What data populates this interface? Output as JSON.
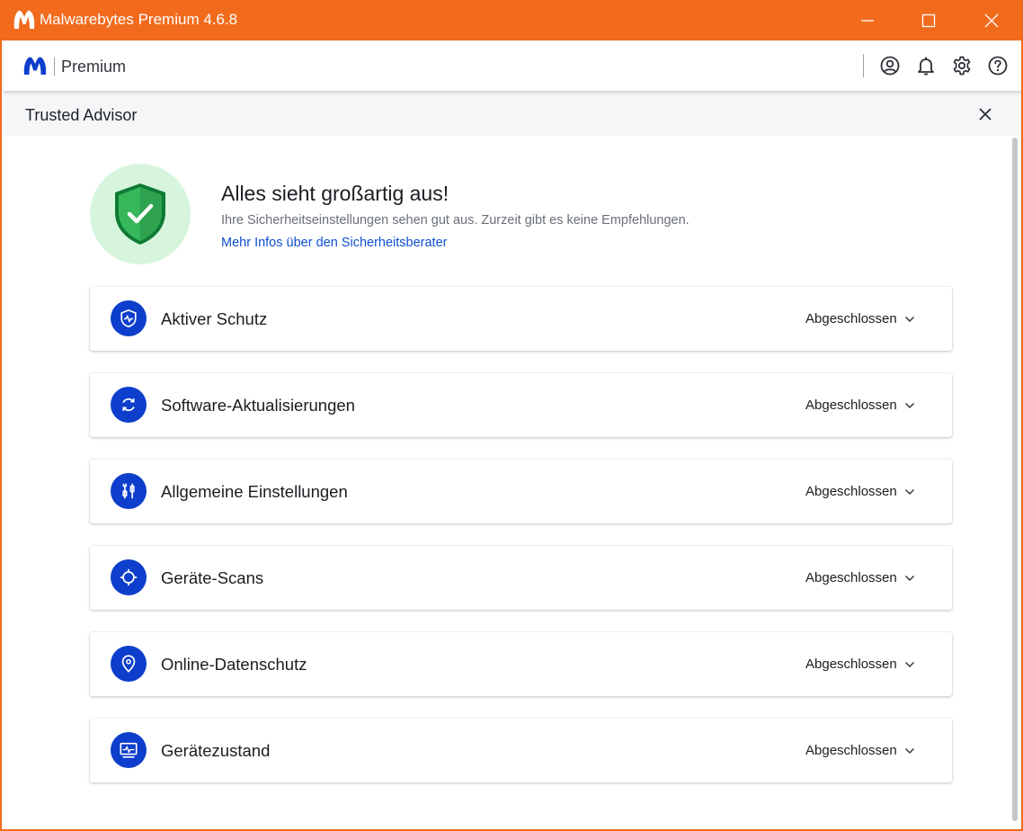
{
  "window": {
    "title": "Malwarebytes Premium 4.6.8",
    "accent_color": "#f26b1d",
    "controls": [
      "minimize-icon",
      "maximize-icon",
      "close-icon"
    ]
  },
  "header": {
    "brand_label": "Premium",
    "brand_color": "#0d3ecc",
    "icons": [
      "account-icon",
      "bell-icon",
      "gear-icon",
      "help-icon"
    ]
  },
  "panel": {
    "title": "Trusted Advisor"
  },
  "status": {
    "title": "Alles sieht großartig aus!",
    "subtitle": "Ihre Sicherheitseinstellungen sehen gut aus. Zurzeit gibt es keine Empfehlungen.",
    "link": "Mehr Infos über den Sicherheitsberater",
    "badge_color": "#d7f5dd",
    "shield_color": "#2eab4f"
  },
  "categories": [
    {
      "label": "Aktiver Schutz",
      "status": "Abgeschlossen",
      "icon": "shield-pulse-icon"
    },
    {
      "label": "Software-Aktualisierungen",
      "status": "Abgeschlossen",
      "icon": "refresh-icon"
    },
    {
      "label": "Allgemeine Einstellungen",
      "status": "Abgeschlossen",
      "icon": "tools-icon"
    },
    {
      "label": "Geräte-Scans",
      "status": "Abgeschlossen",
      "icon": "crosshair-icon"
    },
    {
      "label": "Online-Datenschutz",
      "status": "Abgeschlossen",
      "icon": "location-pin-icon"
    },
    {
      "label": "Gerätezustand",
      "status": "Abgeschlossen",
      "icon": "monitor-pulse-icon"
    }
  ]
}
